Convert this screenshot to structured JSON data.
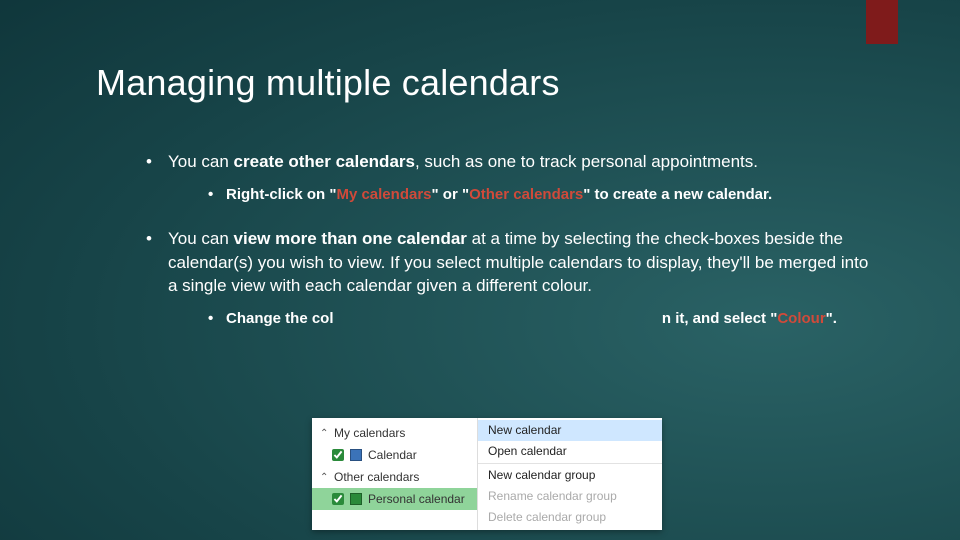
{
  "accent_color": "#7f1b1b",
  "title": "Managing multiple calendars",
  "bullets": {
    "b1_pre": "You can ",
    "b1_bold": "create other calendars",
    "b1_post": ", such as one to track personal appointments.",
    "b1_sub_pre": "Right-click on \"",
    "b1_sub_kw1": "My calendars",
    "b1_sub_mid": "\" or \"",
    "b1_sub_kw2": "Other calendars",
    "b1_sub_post": "\" to create a new calendar.",
    "b2_pre": "You can ",
    "b2_bold": "view more than one calendar",
    "b2_post": " at a time by selecting the check-boxes beside the calendar(s) you wish to view. If you select multiple calendars to display, they'll be merged into a single view with each calendar given a different colour.",
    "b2_sub_pre": "Change the col",
    "b2_sub_post": "n it, and select \"",
    "b2_sub_kw": "Colour",
    "b2_sub_end": "\"."
  },
  "mock": {
    "section1": "My calendars",
    "item1": "Calendar",
    "swatch1": "#3b73b9",
    "section2": "Other calendars",
    "item2": "Personal calendar",
    "swatch2": "#2a8a3a",
    "menu": {
      "m1": "New calendar",
      "m2": "Open calendar",
      "m3": "New calendar group",
      "m4": "Rename calendar group",
      "m5": "Delete calendar group"
    }
  }
}
